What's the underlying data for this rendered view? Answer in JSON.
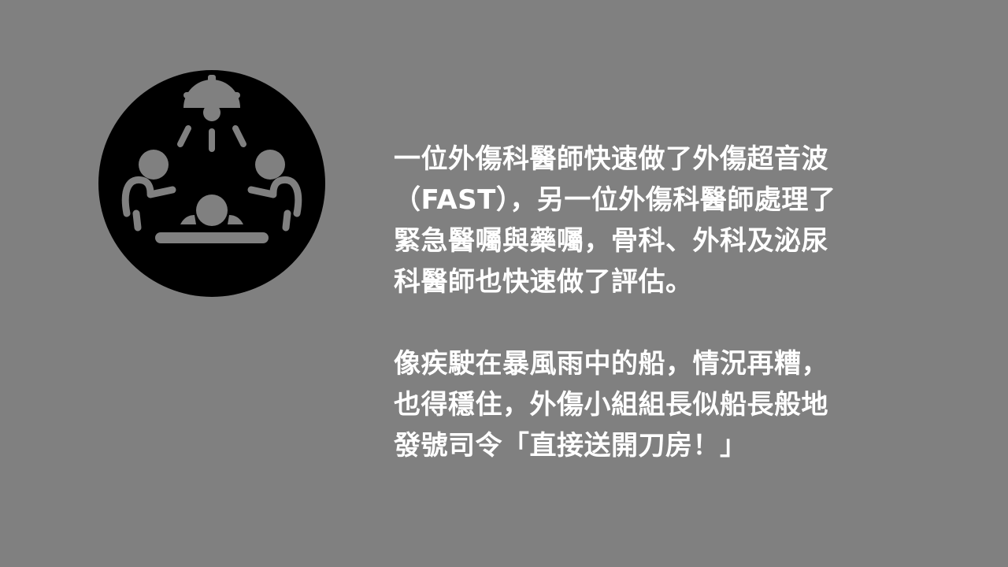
{
  "icon": {
    "name": "surgical-team-icon",
    "background_color": "#000000",
    "foreground_color": "#808080"
  },
  "paragraph1": {
    "lines": [
      "一位外傷科醫師快速做了外傷超音波",
      "（FAST），另一位外傷科醫師處理了",
      "緊急醫囑與藥囑，骨科、外科及泌尿",
      "科醫師也快速做了評估。"
    ]
  },
  "paragraph2": {
    "lines": [
      "像疾駛在暴風雨中的船，情況再糟，",
      "也得穩住，外傷小組組長似船長般地",
      "發號司令「直接送開刀房！」"
    ]
  },
  "colors": {
    "slide_background": "#808080",
    "text": "#ffffff"
  }
}
